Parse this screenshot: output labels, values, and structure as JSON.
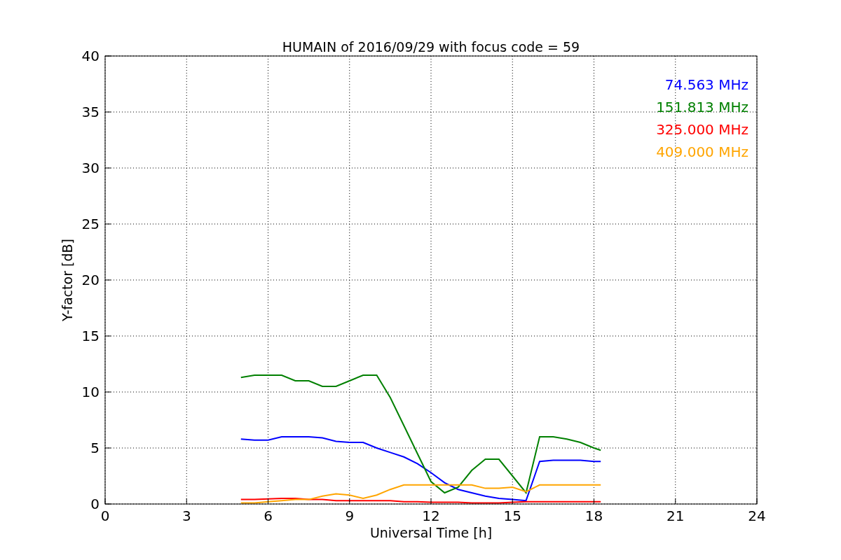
{
  "chart_data": {
    "type": "line",
    "title": "HUMAIN of 2016/09/29 with focus code = 59",
    "xlabel": "Universal Time [h]",
    "ylabel": "Y-factor [dB]",
    "x": [
      5,
      5.5,
      6,
      6.5,
      7,
      7.5,
      8,
      8.5,
      9,
      9.5,
      10,
      10.5,
      11,
      11.5,
      12,
      12.5,
      13,
      13.5,
      14,
      14.5,
      15,
      15.5,
      16,
      16.5,
      17,
      17.5,
      18,
      18.25
    ],
    "series": [
      {
        "name": "74.563 MHz",
        "color": "#0000ff",
        "values": [
          5.8,
          5.7,
          5.7,
          6.0,
          6.0,
          6.0,
          5.9,
          5.6,
          5.5,
          5.5,
          5.0,
          4.6,
          4.2,
          3.6,
          2.8,
          1.9,
          1.3,
          1.0,
          0.7,
          0.5,
          0.4,
          0.3,
          3.8,
          3.9,
          3.9,
          3.9,
          3.8,
          3.8
        ]
      },
      {
        "name": "151.813 MHz",
        "color": "#008000",
        "values": [
          11.3,
          11.5,
          11.5,
          11.5,
          11.0,
          11.0,
          10.5,
          10.5,
          11.0,
          11.5,
          11.5,
          9.5,
          7,
          4.5,
          2,
          1,
          1.5,
          3,
          4,
          4,
          2.5,
          1,
          6,
          6,
          5.8,
          5.5,
          5,
          4.8
        ]
      },
      {
        "name": "325.000 MHz",
        "color": "#ff0000",
        "values": [
          0.4,
          0.4,
          0.45,
          0.5,
          0.5,
          0.4,
          0.4,
          0.3,
          0.3,
          0.3,
          0.3,
          0.3,
          0.2,
          0.2,
          0.15,
          0.15,
          0.15,
          0.1,
          0.1,
          0.1,
          0.15,
          0.2,
          0.2,
          0.2,
          0.2,
          0.2,
          0.2,
          0.2
        ]
      },
      {
        "name": "409.000 MHz",
        "color": "#ffa500",
        "values": [
          0.1,
          0.1,
          0.2,
          0.3,
          0.4,
          0.4,
          0.7,
          0.9,
          0.8,
          0.5,
          0.8,
          1.3,
          1.7,
          1.7,
          1.7,
          1.7,
          1.7,
          1.7,
          1.4,
          1.4,
          1.5,
          1.1,
          1.7,
          1.7,
          1.7,
          1.7,
          1.7,
          1.7
        ]
      }
    ],
    "xlim": [
      0,
      24
    ],
    "ylim": [
      0,
      40
    ],
    "xticks": [
      0,
      3,
      6,
      9,
      12,
      15,
      18,
      21,
      24
    ],
    "yticks": [
      0,
      5,
      10,
      15,
      20,
      25,
      30,
      35,
      40
    ],
    "grid": true
  }
}
